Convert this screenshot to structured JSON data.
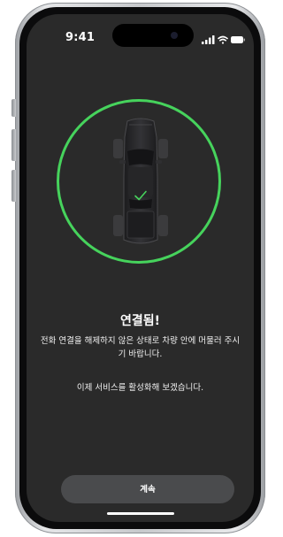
{
  "status_bar": {
    "time": "9:41"
  },
  "connection": {
    "title": "연결됨!",
    "description": "전화 연결을 해제하지 않은 상태로 차량 안에 머물러 주시기 바랍니다.",
    "activation_note": "이제 서비스를 활성화해 보겠습니다."
  },
  "actions": {
    "continue_label": "계속"
  },
  "colors": {
    "ring": "#46d35c",
    "check": "#46d35c",
    "screen_bg": "#2a2a2a",
    "button_bg": "#4a4b4d"
  },
  "icons": [
    "signal-icon",
    "wifi-icon",
    "battery-icon",
    "car-icon",
    "check-icon"
  ]
}
